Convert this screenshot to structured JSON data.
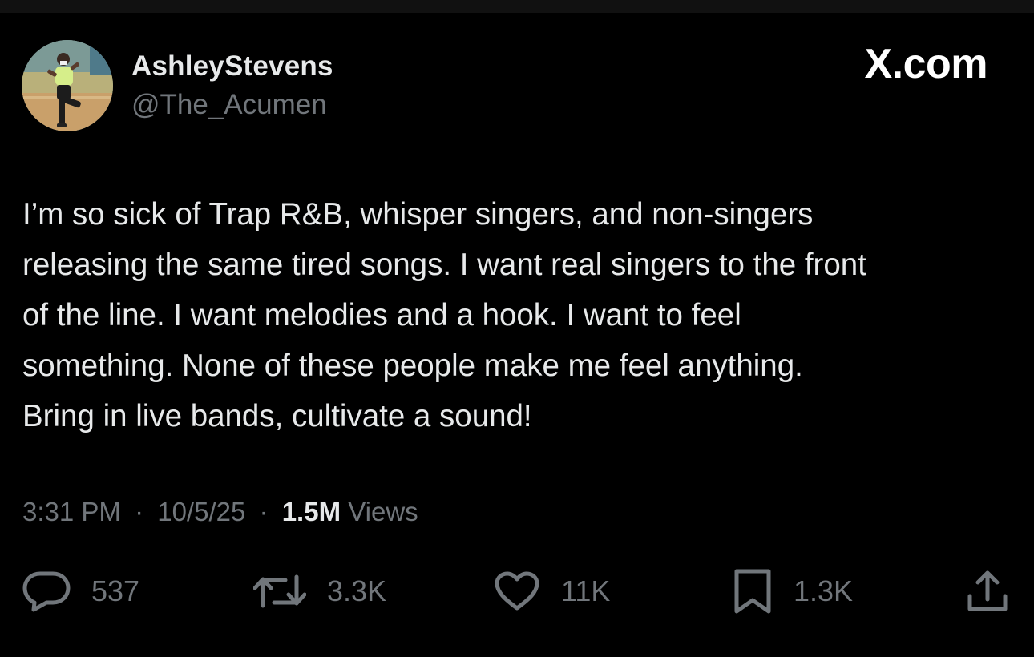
{
  "author": {
    "display_name": "AshleyStevens",
    "handle": "@The_Acumen"
  },
  "brand": {
    "text": "X.com",
    "icon": "x-logo-icon"
  },
  "tweet": {
    "lines": [
      "I’m so sick of Trap R&B, whisper singers, and non-singers",
      "releasing the same tired songs. I want real singers to the front",
      "of the line. I want melodies and a hook. I want to feel",
      "something. None of these people make me feel anything.",
      "Bring in live bands, cultivate a sound!"
    ]
  },
  "meta": {
    "time": "3:31 PM",
    "date": "10/5/25",
    "separator": "·",
    "views_count": "1.5M",
    "views_label": "Views"
  },
  "actions": {
    "replies": {
      "icon": "reply-icon",
      "count": "537"
    },
    "reposts": {
      "icon": "repost-icon",
      "count": "3.3K"
    },
    "likes": {
      "icon": "heart-icon",
      "count": "11K"
    },
    "bookmarks": {
      "icon": "bookmark-icon",
      "count": "1.3K"
    },
    "share": {
      "icon": "share-icon"
    }
  },
  "colors": {
    "background": "#000000",
    "primary_text": "#e7e9ea",
    "secondary_text": "#71767b"
  }
}
